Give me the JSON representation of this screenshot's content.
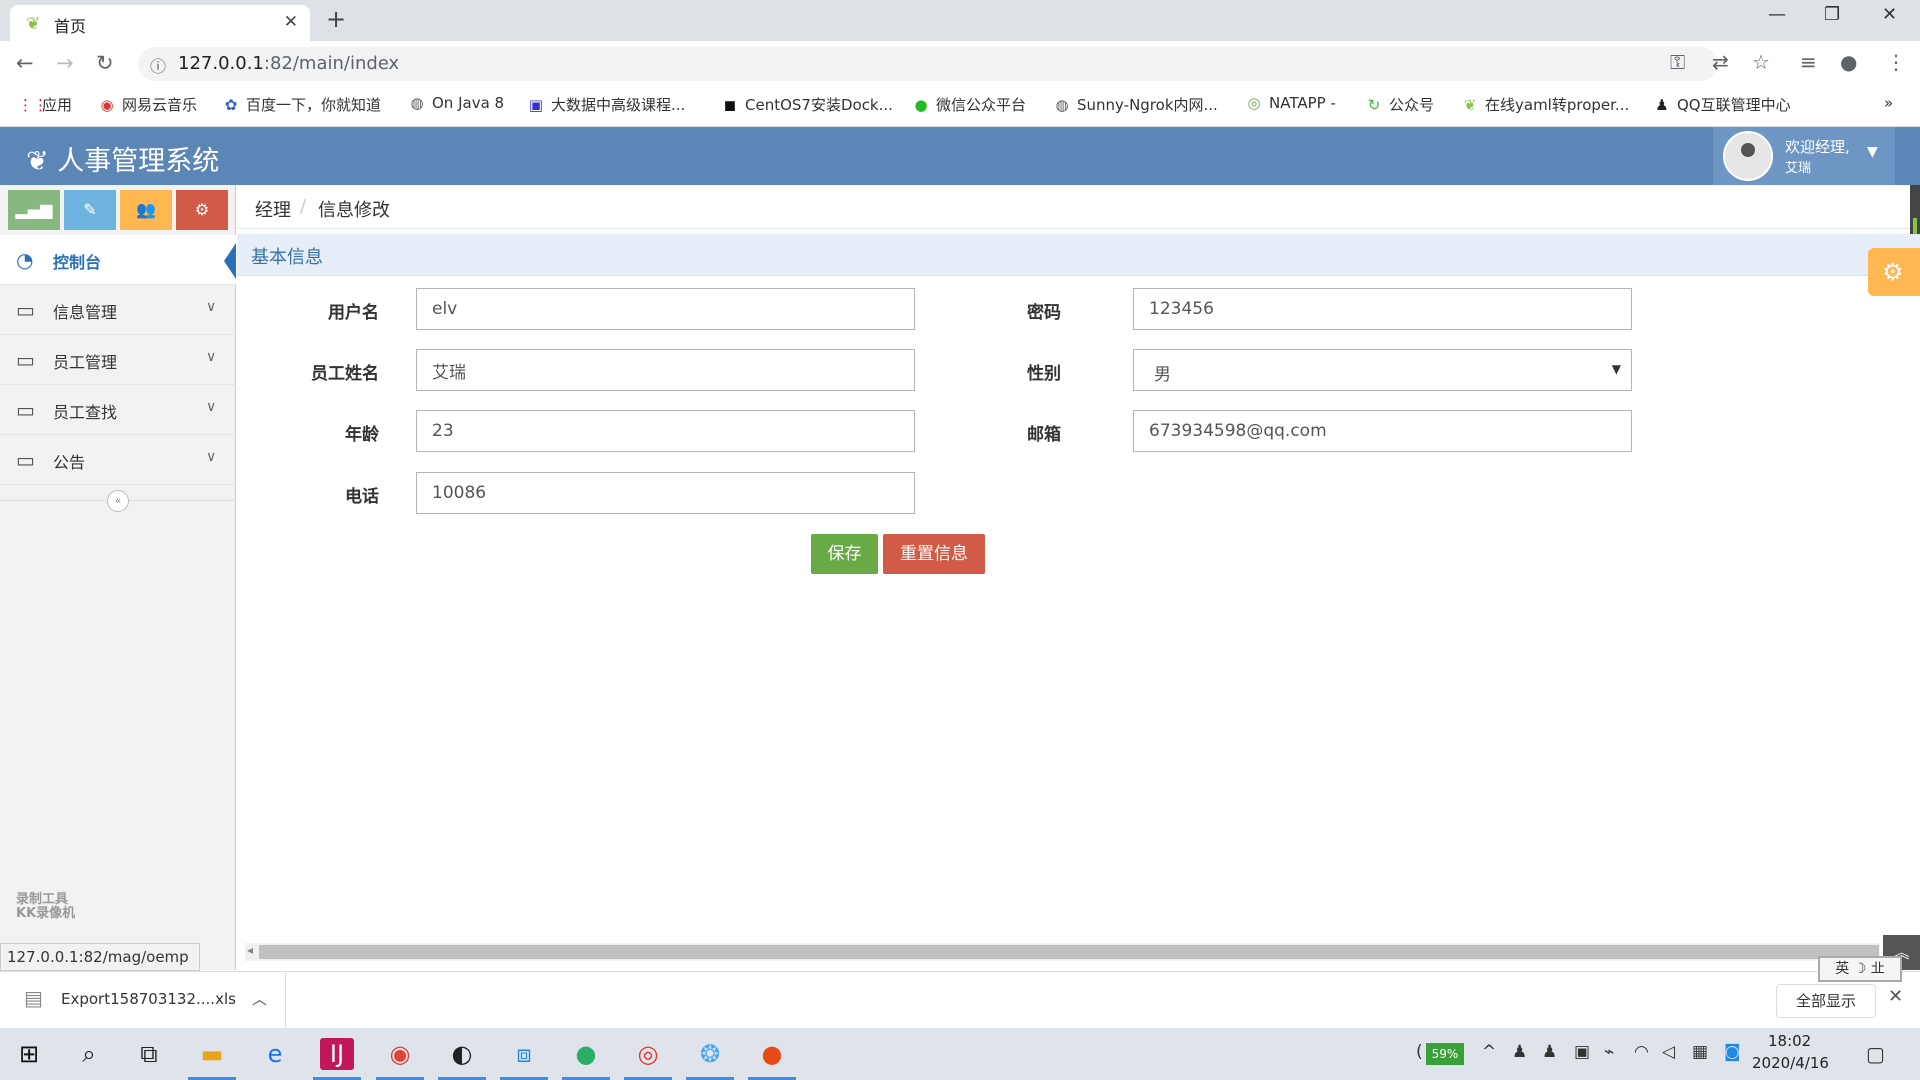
{
  "browser": {
    "tab_title": "首页",
    "url_host": "127.0.0.1",
    "url_rest": ":82/main/index",
    "bookmarks": [
      "应用",
      "网易云音乐",
      "百度一下，你就知道",
      "On Java 8",
      "大数据中高级课程...",
      "CentOS7安装Dock...",
      "微信公众平台",
      "Sunny-Ngrok内网...",
      "NATAPP -",
      "公众号",
      "在线yaml转proper...",
      "QQ互联管理中心"
    ],
    "bookmark_more": "»"
  },
  "app": {
    "title": "人事管理系统",
    "welcome": "欢迎经理,",
    "user_name": "艾瑞"
  },
  "sidebar": {
    "items": [
      {
        "label": "控制台"
      },
      {
        "label": "信息管理"
      },
      {
        "label": "员工管理"
      },
      {
        "label": "员工查找"
      },
      {
        "label": "公告"
      }
    ],
    "watermark_line1": "录制工具",
    "watermark_line2": "KK录像机"
  },
  "breadcrumb": {
    "root": "经理",
    "separator": "/",
    "current": "信息修改"
  },
  "section": {
    "title": "基本信息"
  },
  "form": {
    "username_label": "用户名",
    "username_value": "elv",
    "password_label": "密码",
    "password_value": "123456",
    "name_label": "员工姓名",
    "name_value": "艾瑞",
    "gender_label": "性别",
    "gender_value": "男",
    "age_label": "年龄",
    "age_value": "23",
    "email_label": "邮箱",
    "email_value": "673934598@qq.com",
    "phone_label": "电话",
    "phone_value": "10086",
    "save_label": "保存",
    "reset_label": "重置信息"
  },
  "status_url": "127.0.0.1:82/mag/oemp",
  "download": {
    "filename": "Export158703132....xls",
    "show_all": "全部显示"
  },
  "ime": "英 ☽ 㐀",
  "taskbar": {
    "battery": "59%",
    "time": "18:02",
    "date": "2020/4/16"
  },
  "colors": {
    "header": "#5b86b5",
    "accent": "#2a6fb8",
    "save": "#69aa46",
    "reset": "#d15b47"
  }
}
